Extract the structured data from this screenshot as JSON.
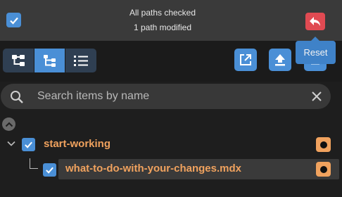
{
  "header": {
    "status_line1": "All paths checked",
    "status_line2": "1 path modified",
    "reset_tooltip": "Reset"
  },
  "search": {
    "placeholder": "Search items by name"
  },
  "tree": {
    "folder": {
      "name": "start-working",
      "checked": true
    },
    "file": {
      "name": "what-to-do-with-your-changes.mdx",
      "checked": true
    }
  },
  "colors": {
    "accent": "#4a8fd6",
    "danger": "#e04a52",
    "modified": "#f0a25e"
  }
}
